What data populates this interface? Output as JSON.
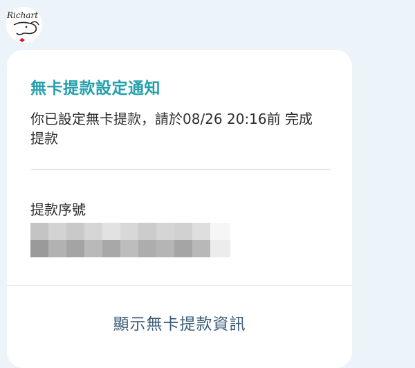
{
  "watermark": {
    "text": "Richart"
  },
  "notification": {
    "title": "無卡提款設定通知",
    "message": "你已設定無卡提款，請於08/26 20:16前 完成提款",
    "serial_label": "提款序號",
    "serial_value_state": "pixelated (redacted)",
    "action_label": "顯示無卡提款資訊"
  },
  "colors": {
    "title": "#23a0ab",
    "action": "#3c5d78",
    "background": "#ecf3f9",
    "card": "#ffffff"
  }
}
